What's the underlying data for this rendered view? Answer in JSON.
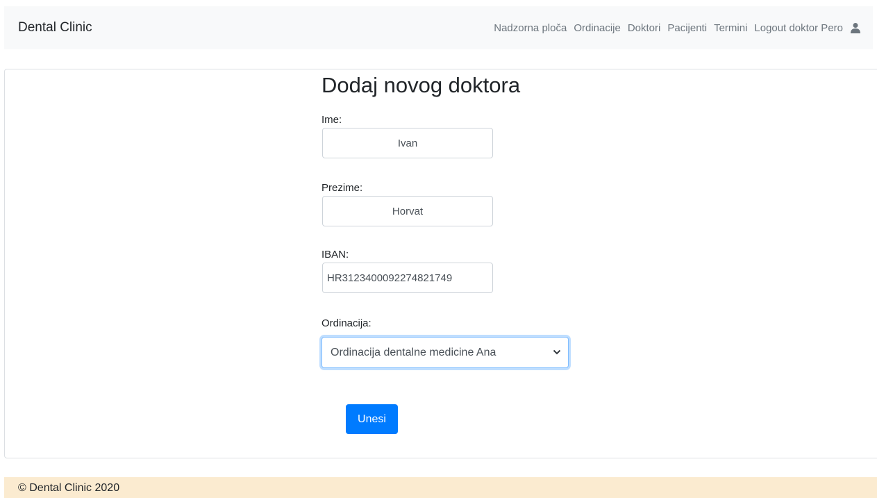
{
  "navbar": {
    "brand": "Dental Clinic",
    "links": [
      "Nadzorna ploča",
      "Ordinacije",
      "Doktori",
      "Pacijenti",
      "Termini",
      "Logout doktor Pero"
    ],
    "user_icon": "user-icon"
  },
  "form": {
    "title": "Dodaj novog doktora",
    "first_name": {
      "label": "Ime:",
      "value": "Ivan"
    },
    "last_name": {
      "label": "Prezime:",
      "value": "Horvat"
    },
    "iban": {
      "label": "IBAN:",
      "value": "HR3123400092274821749"
    },
    "clinic": {
      "label": "Ordinacija:",
      "selected": "Ordinacija dentalne medicine Ana"
    },
    "submit_label": "Unesi"
  },
  "footer": {
    "text": "© Dental Clinic 2020"
  },
  "colors": {
    "primary": "#007bff",
    "navbar_bg": "#f8f9fa",
    "footer_bg": "#fbebd0"
  }
}
